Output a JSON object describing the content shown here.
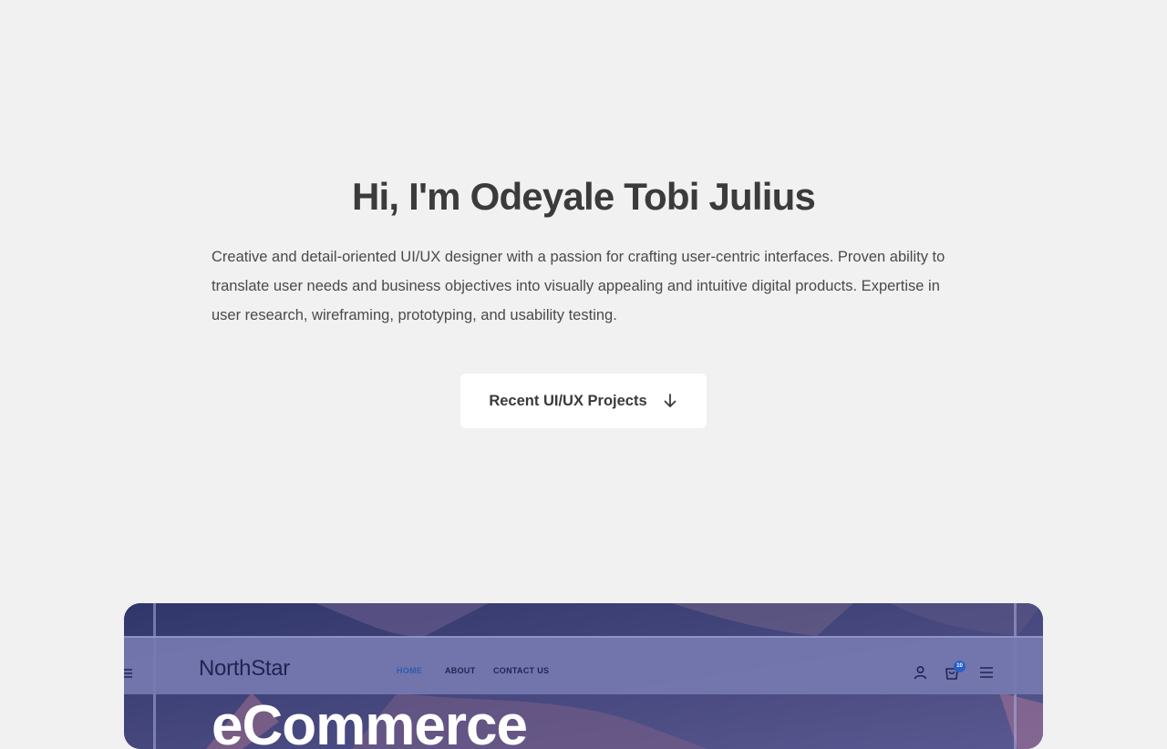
{
  "hero": {
    "title": "Hi, I'm Odeyale Tobi Julius",
    "description": "Creative and detail-oriented UI/UX designer with a passion for crafting user-centric interfaces. Proven ability to translate user needs and business objectives into visually appealing and intuitive digital products. Expertise in user research, wireframing, prototyping, and usability testing.",
    "cta_label": "Recent UI/UX Projects",
    "cta_icon": "arrow-down-icon"
  },
  "project_card": {
    "logo": "NorthStar",
    "nav": [
      "HOME",
      "ABOUT",
      "CONTACT US"
    ],
    "active_nav": "HOME",
    "cart_count": "10",
    "headline": "eCommerce",
    "icons": [
      "menu-icon",
      "user-icon",
      "cart-icon",
      "hamburger-icon"
    ]
  },
  "colors": {
    "background": "#f1f1f1",
    "button_bg": "#ffffff",
    "text": "#3d3d3d",
    "card_bg": "#4b4f86",
    "accent": "#2c5fc4"
  }
}
